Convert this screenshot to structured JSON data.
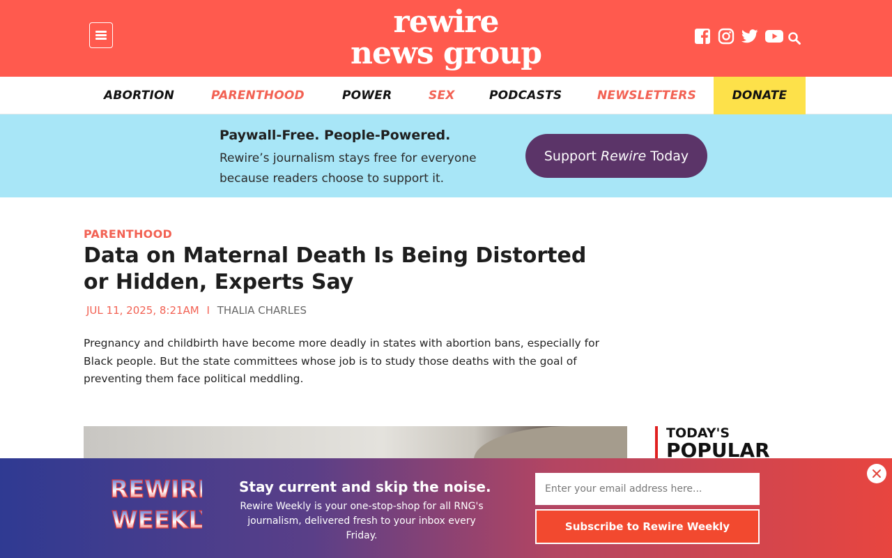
{
  "header": {
    "logo_line1": "rewire",
    "logo_line2": "news group",
    "social_icons": [
      "facebook-icon",
      "instagram-icon",
      "twitter-icon",
      "youtube-icon",
      "search-icon"
    ],
    "background_color": "#ff5a4e"
  },
  "nav": {
    "items": [
      {
        "label": "ABORTION",
        "color": "#111111"
      },
      {
        "label": "PARENTHOOD",
        "color": "#f26153"
      },
      {
        "label": "POWER",
        "color": "#111111"
      },
      {
        "label": "SEX",
        "color": "#f26153"
      },
      {
        "label": "PODCASTS",
        "color": "#111111"
      },
      {
        "label": "NEWSLETTERS",
        "color": "#f26153"
      }
    ],
    "donate_label": "DONATE",
    "donate_color": "#fde14a"
  },
  "paywall": {
    "title": "Paywall-Free. People-Powered.",
    "body": "Rewire’s journalism stays free for everyone because readers choose to support it.",
    "button_prefix": "Support",
    "button_italic": "Rewire",
    "button_suffix": "Today",
    "background_color": "#a8e6f7",
    "button_color": "#5b3468"
  },
  "article": {
    "category": "PARENTHOOD",
    "headline": "Data on Maternal Death Is Being Distorted or Hidden, Experts Say",
    "date": "JUL 11, 2025, 8:21AM",
    "separator": "I",
    "author": "THALIA CHARLES",
    "dek": "Pregnancy and childbirth have become more deadly in states with abortion bans, especially for Black people. But the state committees whose job is to study those deaths with the goal of preventing them face political meddling."
  },
  "sidebar": {
    "popular_line1": "TODAY'S",
    "popular_line2": "POPULAR"
  },
  "newsletter": {
    "logo_line1": "REWIRE",
    "logo_line2": "WEEKLY",
    "heading": "Stay current and skip the noise.",
    "body": "Rewire Weekly is your one-stop-shop for all RNG's journalism, delivered fresh to your inbox every Friday.",
    "email_placeholder": "Enter your email address here...",
    "submit_label": "Subscribe to Rewire Weekly"
  }
}
